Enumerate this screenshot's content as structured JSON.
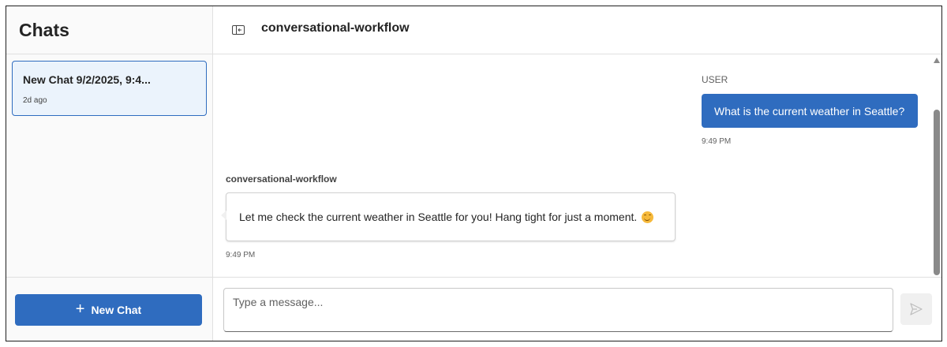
{
  "sidebar": {
    "title": "Chats",
    "chats": [
      {
        "title": "New Chat 9/2/2025, 9:4...",
        "time": "2d ago"
      }
    ],
    "new_chat_label": "New Chat"
  },
  "header": {
    "title": "conversational-workflow",
    "toggle_icon": "panel-collapse-icon"
  },
  "messages": [
    {
      "role_label": "USER",
      "text": "What is the current weather in Seattle?",
      "time": "9:49 PM"
    },
    {
      "role_label": "conversational-workflow",
      "text": "Let me check the current weather in Seattle for you! Hang tight for just a moment.",
      "emoji": "smiling-face-icon",
      "time": "9:49 PM"
    }
  ],
  "composer": {
    "placeholder": "Type a message...",
    "value": "",
    "send_icon": "send-icon"
  },
  "colors": {
    "accent": "#2f6cbf",
    "selected_bg": "#ebf3fc",
    "sidebar_bg": "#fafafa",
    "border": "#e0e0e0"
  }
}
